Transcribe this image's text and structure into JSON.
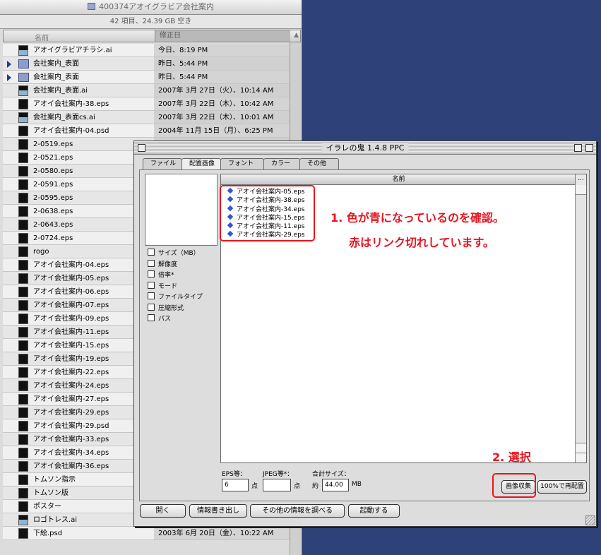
{
  "finder": {
    "title": "400374アオイグラビア会社案内",
    "info": "42 項目、24.39 GB 空き",
    "col_name": "名前",
    "col_date": "修正日",
    "rows": [
      {
        "name": "アオイグラビアチラシ.ai",
        "date": "今日、8:19 PM",
        "icon": "doc"
      },
      {
        "name": "会社案内_表面",
        "date": "昨日、5:44 PM",
        "icon": "folder"
      },
      {
        "name": "会社案内_表面",
        "date": "昨日、5:44 PM",
        "icon": "folder"
      },
      {
        "name": "会社案内_表面.ai",
        "date": "2007年 3月 27日（火）、10:14 AM",
        "icon": "doc"
      },
      {
        "name": "アオイ会社案内-38.eps",
        "date": "2007年 3月 22日（木）、10:42 AM",
        "icon": "img"
      },
      {
        "name": "会社案内_表面cs.ai",
        "date": "2007年 3月 22日（木）、10:01 AM",
        "icon": "doc"
      },
      {
        "name": "アオイ会社案内-04.psd",
        "date": "2004年 11月 15日（月）、6:25 PM",
        "icon": "img"
      },
      {
        "name": "2-0519.eps",
        "date": "",
        "icon": "img"
      },
      {
        "name": "2-0521.eps",
        "date": "",
        "icon": "img"
      },
      {
        "name": "2-0580.eps",
        "date": "",
        "icon": "img"
      },
      {
        "name": "2-0591.eps",
        "date": "",
        "icon": "img"
      },
      {
        "name": "2-0595.eps",
        "date": "",
        "icon": "img"
      },
      {
        "name": "2-0638.eps",
        "date": "",
        "icon": "img"
      },
      {
        "name": "2-0643.eps",
        "date": "",
        "icon": "img"
      },
      {
        "name": "2-0724.eps",
        "date": "",
        "icon": "img"
      },
      {
        "name": "rogo",
        "date": "",
        "icon": "img"
      },
      {
        "name": "アオイ会社案内-04.eps",
        "date": "",
        "icon": "img"
      },
      {
        "name": "アオイ会社案内-05.eps",
        "date": "",
        "icon": "img"
      },
      {
        "name": "アオイ会社案内-06.eps",
        "date": "",
        "icon": "img"
      },
      {
        "name": "アオイ会社案内-07.eps",
        "date": "",
        "icon": "img"
      },
      {
        "name": "アオイ会社案内-09.eps",
        "date": "",
        "icon": "img"
      },
      {
        "name": "アオイ会社案内-11.eps",
        "date": "",
        "icon": "img"
      },
      {
        "name": "アオイ会社案内-15.eps",
        "date": "",
        "icon": "img"
      },
      {
        "name": "アオイ会社案内-19.eps",
        "date": "",
        "icon": "img"
      },
      {
        "name": "アオイ会社案内-22.eps",
        "date": "",
        "icon": "img"
      },
      {
        "name": "アオイ会社案内-24.eps",
        "date": "",
        "icon": "img"
      },
      {
        "name": "アオイ会社案内-27.eps",
        "date": "",
        "icon": "img"
      },
      {
        "name": "アオイ会社案内-29.eps",
        "date": "",
        "icon": "img"
      },
      {
        "name": "アオイ会社案内-29.psd",
        "date": "",
        "icon": "img"
      },
      {
        "name": "アオイ会社案内-33.eps",
        "date": "",
        "icon": "img"
      },
      {
        "name": "アオイ会社案内-34.eps",
        "date": "",
        "icon": "img"
      },
      {
        "name": "アオイ会社案内-36.eps",
        "date": "",
        "icon": "img"
      },
      {
        "name": "トムソン指示",
        "date": "",
        "icon": "img"
      },
      {
        "name": "トムソン版",
        "date": "",
        "icon": "img"
      },
      {
        "name": "ポスター",
        "date": "",
        "icon": "img"
      },
      {
        "name": "ロゴトレス.ai",
        "date": "",
        "icon": "doc"
      },
      {
        "name": "下絵.psd",
        "date": "2003年 6月 20日（金）、10:22 AM",
        "icon": "img"
      }
    ]
  },
  "oni": {
    "title": "イラレの鬼 1.4.8 PPC",
    "tabs": [
      "ファイル",
      "配置画像",
      "フォント",
      "カラー",
      "その他"
    ],
    "list_header": "名前",
    "list_more": "...",
    "checks": [
      "サイズ（MB）",
      "解像度",
      "倍率*",
      "モード",
      "ファイルタイプ",
      "圧縮形式",
      "パス"
    ],
    "files": [
      "アオイ会社案内-05.eps",
      "アオイ会社案内-38.eps",
      "アオイ会社案内-34.eps",
      "アオイ会社案内-15.eps",
      "アオイ会社案内-11.eps",
      "アオイ会社案内-29.eps"
    ],
    "eps_label": "EPS等：",
    "eps_value": "6",
    "eps_unit": "点",
    "jpeg_label": "JPEG等*：",
    "jpeg_value": "",
    "jpeg_unit": "点",
    "total_label": "合計サイズ：",
    "total_prefix": "約",
    "total_value": "44.00",
    "total_unit": "MB",
    "collect_button": "画像収集",
    "replace_button": "100%で再配置",
    "bottom_buttons": [
      "開く",
      "情報書き出し",
      "その他の情報を調べる",
      "起動する"
    ]
  },
  "annotations": {
    "note1": "1. 色が青になっているのを確認。",
    "note2": "赤はリンク切れしています。",
    "note3": "2. 選択"
  }
}
